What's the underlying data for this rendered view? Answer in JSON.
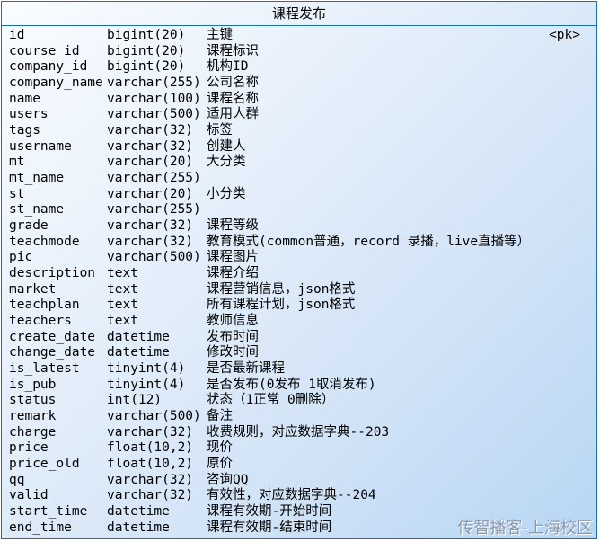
{
  "entity": {
    "title": "课程发布",
    "columns": [
      {
        "name": "id",
        "type": "bigint(20)",
        "comment": "主键",
        "key": "<pk>"
      },
      {
        "name": "course_id",
        "type": "bigint(20)",
        "comment": "课程标识",
        "key": ""
      },
      {
        "name": "company_id",
        "type": "bigint(20)",
        "comment": "机构ID",
        "key": ""
      },
      {
        "name": "company_name",
        "type": "varchar(255)",
        "comment": "公司名称",
        "key": ""
      },
      {
        "name": "name",
        "type": "varchar(100)",
        "comment": "课程名称",
        "key": ""
      },
      {
        "name": "users",
        "type": "varchar(500)",
        "comment": "适用人群",
        "key": ""
      },
      {
        "name": "tags",
        "type": "varchar(32)",
        "comment": "标签",
        "key": ""
      },
      {
        "name": "username",
        "type": "varchar(32)",
        "comment": "创建人",
        "key": ""
      },
      {
        "name": "mt",
        "type": "varchar(20)",
        "comment": "大分类",
        "key": ""
      },
      {
        "name": "mt_name",
        "type": "varchar(255)",
        "comment": "",
        "key": ""
      },
      {
        "name": "st",
        "type": "varchar(20)",
        "comment": "小分类",
        "key": ""
      },
      {
        "name": "st_name",
        "type": "varchar(255)",
        "comment": "",
        "key": ""
      },
      {
        "name": "grade",
        "type": "varchar(32)",
        "comment": "课程等级",
        "key": ""
      },
      {
        "name": "teachmode",
        "type": "varchar(32)",
        "comment": "教育模式(common普通，record 录播，live直播等）",
        "key": ""
      },
      {
        "name": "pic",
        "type": "varchar(500)",
        "comment": "课程图片",
        "key": ""
      },
      {
        "name": "description",
        "type": "text",
        "comment": "课程介绍",
        "key": ""
      },
      {
        "name": "market",
        "type": "text",
        "comment": "课程营销信息，json格式",
        "key": ""
      },
      {
        "name": "teachplan",
        "type": "text",
        "comment": "所有课程计划，json格式",
        "key": ""
      },
      {
        "name": "teachers",
        "type": "text",
        "comment": "教师信息",
        "key": ""
      },
      {
        "name": "create_date",
        "type": "datetime",
        "comment": "发布时间",
        "key": ""
      },
      {
        "name": "change_date",
        "type": "datetime",
        "comment": "修改时间",
        "key": ""
      },
      {
        "name": "is_latest",
        "type": "tinyint(4)",
        "comment": "是否最新课程",
        "key": ""
      },
      {
        "name": "is_pub",
        "type": "tinyint(4)",
        "comment": "是否发布(0发布 1取消发布)",
        "key": ""
      },
      {
        "name": "status",
        "type": "int(12)",
        "comment": "状态（1正常  0删除）",
        "key": ""
      },
      {
        "name": "remark",
        "type": "varchar(500)",
        "comment": "备注",
        "key": ""
      },
      {
        "name": "charge",
        "type": "varchar(32)",
        "comment": "收费规则，对应数据字典--203",
        "key": ""
      },
      {
        "name": "price",
        "type": "float(10,2)",
        "comment": "现价",
        "key": ""
      },
      {
        "name": "price_old",
        "type": "float(10,2)",
        "comment": "原价",
        "key": ""
      },
      {
        "name": "qq",
        "type": "varchar(32)",
        "comment": "咨询QQ",
        "key": ""
      },
      {
        "name": "valid",
        "type": "varchar(32)",
        "comment": "有效性，对应数据字典--204",
        "key": ""
      },
      {
        "name": "start_time",
        "type": "datetime",
        "comment": "课程有效期-开始时间",
        "key": ""
      },
      {
        "name": "end_time",
        "type": "datetime",
        "comment": "课程有效期-结束时间",
        "key": ""
      }
    ]
  },
  "watermark": "传智播客-上海校区",
  "colors": {
    "border": "#1e6fa8",
    "gradient_start": "#fafcff",
    "gradient_end": "#b7d6f4",
    "watermark": "#8a9bb0"
  }
}
